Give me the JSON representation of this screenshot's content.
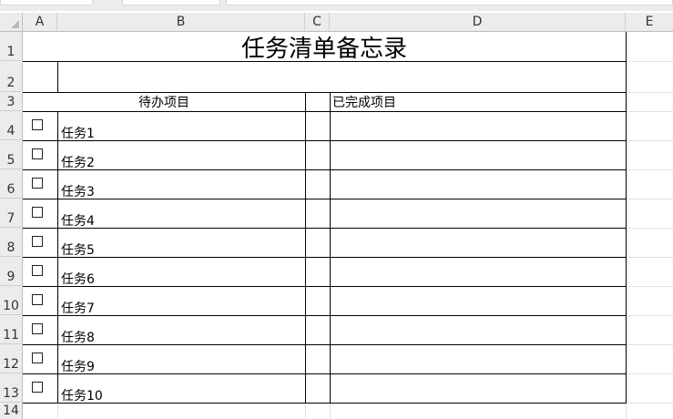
{
  "sheet": {
    "columns": [
      "A",
      "B",
      "C",
      "D",
      "E"
    ],
    "rows": [
      "1",
      "2",
      "3",
      "4",
      "5",
      "6",
      "7",
      "8",
      "9",
      "10",
      "11",
      "12",
      "13",
      "14"
    ],
    "title": "任务清单备忘录",
    "todo_header": "待办项目",
    "done_header": "已完成项目",
    "tasks": [
      "任务1",
      "任务2",
      "任务3",
      "任务4",
      "任务5",
      "任务6",
      "任务7",
      "任务8",
      "任务9",
      "任务10"
    ]
  }
}
